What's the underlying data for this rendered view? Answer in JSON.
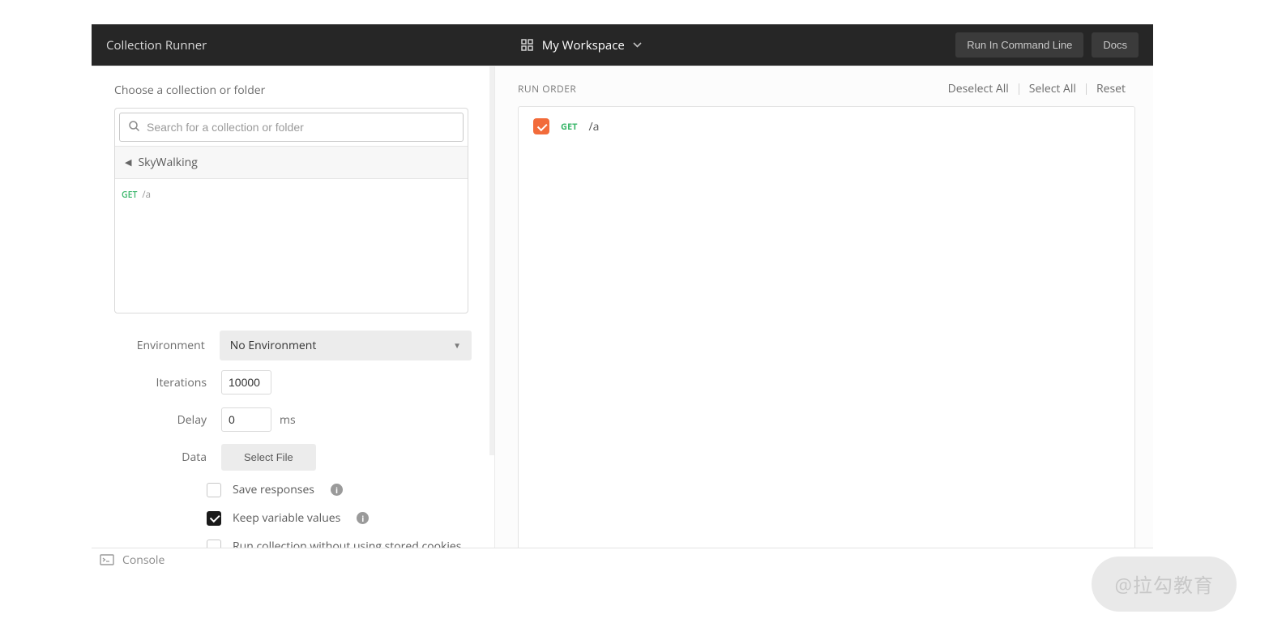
{
  "header": {
    "title": "Collection Runner",
    "workspace": "My Workspace",
    "run_cmd": "Run In Command Line",
    "docs": "Docs"
  },
  "left": {
    "choose_label": "Choose a collection or folder",
    "search_placeholder": "Search for a collection or folder",
    "breadcrumb": "SkyWalking",
    "requests": [
      {
        "method": "GET",
        "path": "/a"
      }
    ],
    "settings": {
      "environment_label": "Environment",
      "environment_value": "No Environment",
      "iterations_label": "Iterations",
      "iterations_value": "10000",
      "delay_label": "Delay",
      "delay_value": "0",
      "delay_unit": "ms",
      "data_label": "Data",
      "select_file": "Select File",
      "save_responses": "Save responses",
      "keep_variable": "Keep variable values",
      "no_cookies": "Run collection without using stored cookies"
    }
  },
  "right": {
    "run_order": "RUN ORDER",
    "deselect_all": "Deselect All",
    "select_all": "Select All",
    "reset": "Reset",
    "items": [
      {
        "method": "GET",
        "path": "/a",
        "checked": true
      }
    ]
  },
  "console": "Console",
  "watermark": "@拉勾教育"
}
